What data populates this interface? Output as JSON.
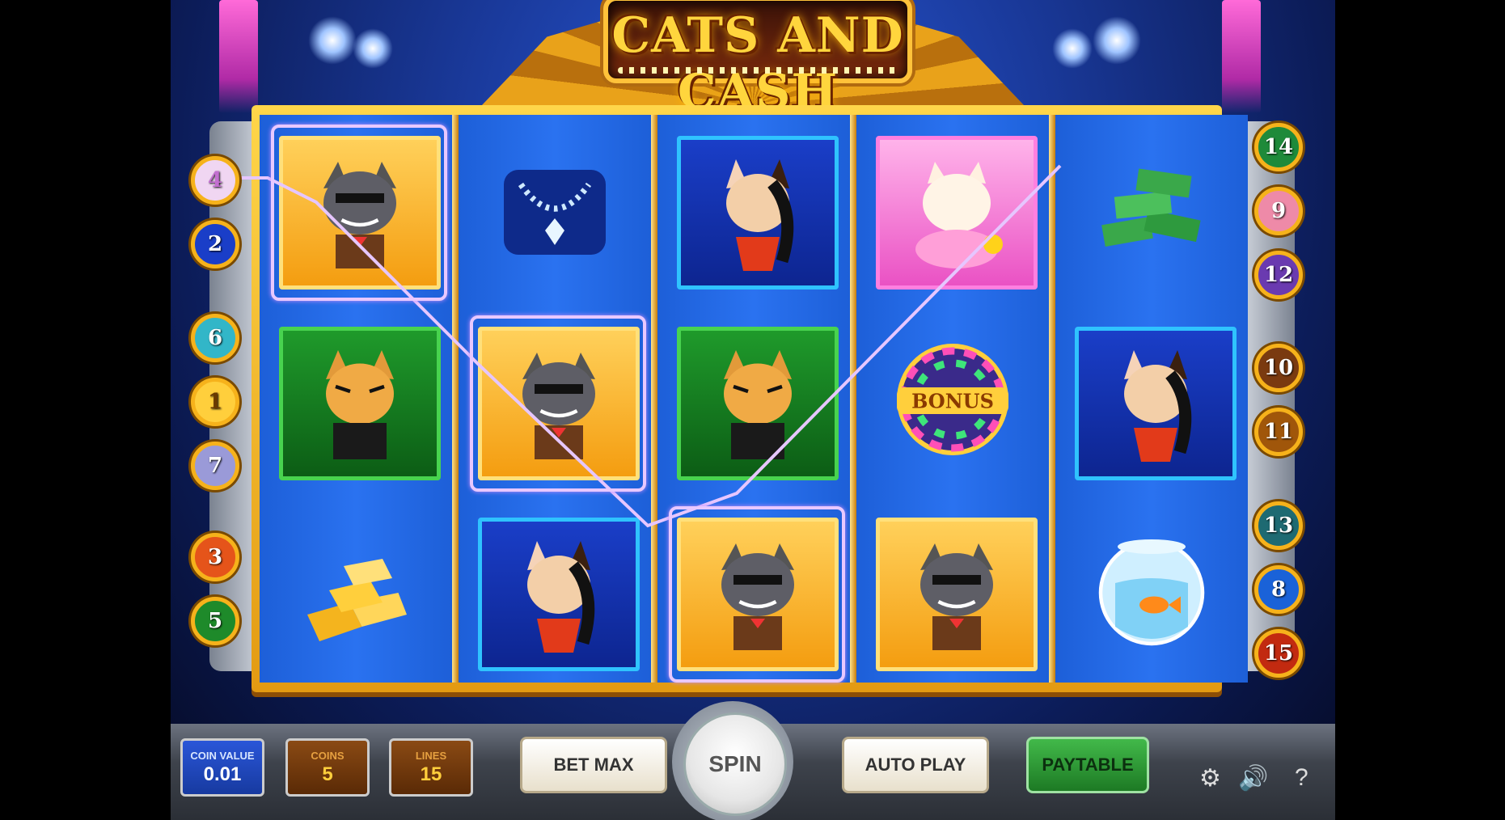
{
  "game": {
    "title": "CATS AND CASH"
  },
  "line_markers": {
    "left": [
      "4",
      "2",
      "6",
      "1",
      "7",
      "3",
      "5"
    ],
    "right": [
      "14",
      "9",
      "12",
      "10",
      "11",
      "13",
      "8",
      "15"
    ]
  },
  "reels": [
    [
      "boss-cat",
      "green-cat",
      "gold-bars"
    ],
    [
      "diamond-necklace",
      "boss-cat",
      "lady-cat"
    ],
    [
      "lady-cat",
      "green-cat",
      "boss-cat"
    ],
    [
      "persian-cat",
      "bonus-wheel",
      "boss-cat"
    ],
    [
      "cash-stack",
      "lady-cat",
      "goldfish-bowl"
    ]
  ],
  "bonus_label": "BONUS",
  "controls": {
    "coin_value_label": "COIN VALUE",
    "coin_value": "0.01",
    "coins_label": "COINS",
    "coins": "5",
    "lines_label": "LINES",
    "lines": "15",
    "bet_max": "BET MAX",
    "spin": "SPIN",
    "auto_play": "AUTO PLAY",
    "paytable": "PAYTABLE",
    "help": "?"
  },
  "colors": {
    "gold": "#ffd53d",
    "reel_blue": "#2a72f0",
    "win_outline": "#e8c8ff",
    "paytable_green": "#1d7a24"
  },
  "icons": {
    "settings": "gear-icon",
    "sound": "speaker-icon",
    "help": "help-icon"
  }
}
